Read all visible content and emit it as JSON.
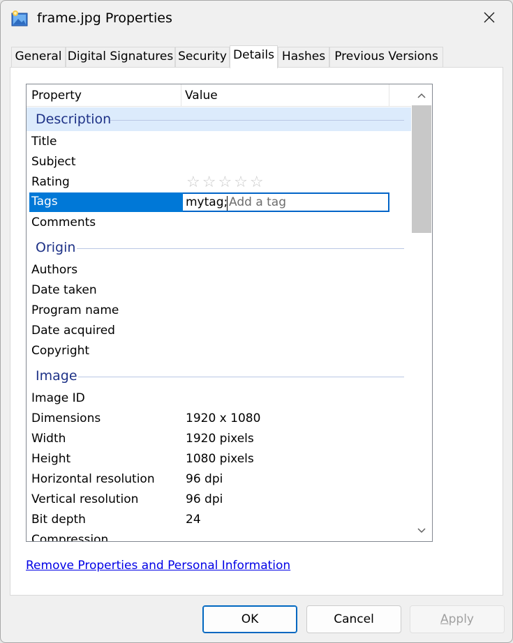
{
  "window": {
    "title": "frame.jpg Properties",
    "close_icon": "close-icon"
  },
  "tabs": [
    {
      "label": "General"
    },
    {
      "label": "Digital Signatures"
    },
    {
      "label": "Security"
    },
    {
      "label": "Details",
      "active": true
    },
    {
      "label": "Hashes"
    },
    {
      "label": "Previous Versions"
    }
  ],
  "list": {
    "header": {
      "property": "Property",
      "value": "Value"
    },
    "groups": {
      "description": "Description",
      "origin": "Origin",
      "image": "Image"
    },
    "rows": {
      "title": "Title",
      "subject": "Subject",
      "rating": "Rating",
      "rating_value": "☆☆☆☆☆",
      "tags": "Tags",
      "tags_value": "mytag;",
      "tags_placeholder": "Add a tag",
      "comments": "Comments",
      "authors": "Authors",
      "date_taken": "Date taken",
      "program_name": "Program name",
      "date_acquired": "Date acquired",
      "copyright": "Copyright",
      "image_id": "Image ID",
      "dimensions": "Dimensions",
      "dimensions_value": "1920 x 1080",
      "width": "Width",
      "width_value": "1920 pixels",
      "height": "Height",
      "height_value": "1080 pixels",
      "hres": "Horizontal resolution",
      "hres_value": "96 dpi",
      "vres": "Vertical resolution",
      "vres_value": "96 dpi",
      "bit_depth": "Bit depth",
      "bit_depth_value": "24",
      "compression": "Compression"
    }
  },
  "link": {
    "remove": "Remove Properties and Personal Information"
  },
  "buttons": {
    "ok": "OK",
    "cancel": "Cancel",
    "apply_accel": "A",
    "apply_rest": "pply"
  },
  "colors": {
    "accent": "#0078d7",
    "group_text": "#1e3287",
    "link": "#0000e6"
  }
}
